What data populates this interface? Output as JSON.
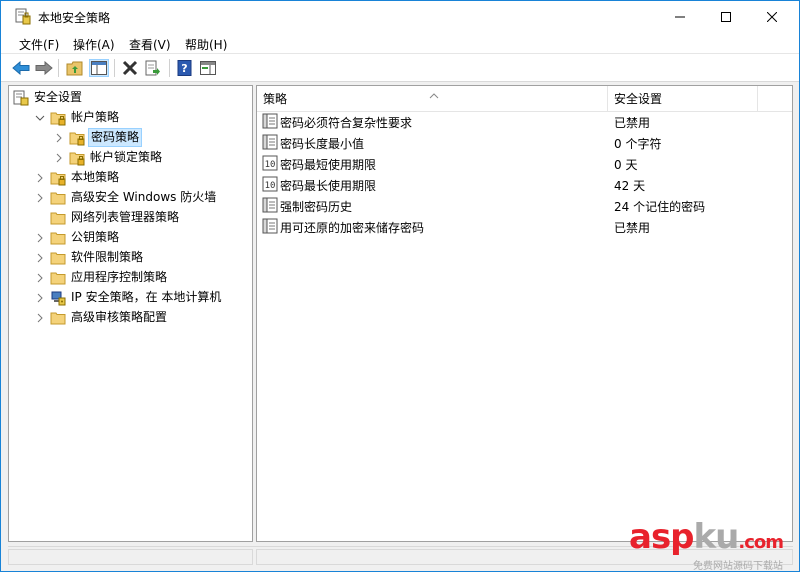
{
  "window": {
    "title": "本地安全策略",
    "app_icon": "security-policy-icon",
    "controls": [
      "minimize-icon",
      "maximize-icon",
      "close-icon"
    ]
  },
  "menu": {
    "file": "文件(F)",
    "action": "操作(A)",
    "view": "查看(V)",
    "help": "帮助(H)"
  },
  "toolbar": {
    "icons": [
      "back-arrow-icon",
      "forward-arrow-icon",
      "up-folder-icon",
      "show-hide-tree-icon",
      "delete-icon",
      "export-list-icon",
      "help-icon",
      "properties-pane-icon"
    ]
  },
  "tree": {
    "items": [
      {
        "label": "安全设置",
        "icon": "security-settings-icon",
        "level": 0,
        "expanded": true
      },
      {
        "label": "帐户策略",
        "icon": "folder-lock-icon",
        "level": 1,
        "expanded": true
      },
      {
        "label": "密码策略",
        "icon": "folder-lock-icon",
        "level": 2,
        "selected": true
      },
      {
        "label": "帐户锁定策略",
        "icon": "folder-lock-icon",
        "level": 2
      },
      {
        "label": "本地策略",
        "icon": "folder-lock-icon",
        "level": 1
      },
      {
        "label": "高级安全 Windows 防火墙",
        "icon": "folder-icon",
        "level": 1
      },
      {
        "label": "网络列表管理器策略",
        "icon": "folder-icon",
        "level": 1
      },
      {
        "label": "公钥策略",
        "icon": "folder-icon",
        "level": 1
      },
      {
        "label": "软件限制策略",
        "icon": "folder-icon",
        "level": 1
      },
      {
        "label": "应用程序控制策略",
        "icon": "folder-icon",
        "level": 1
      },
      {
        "label": "IP 安全策略，在 本地计算机",
        "icon": "ip-security-icon",
        "level": 1
      },
      {
        "label": "高级审核策略配置",
        "icon": "folder-icon",
        "level": 1
      }
    ]
  },
  "list": {
    "columns": [
      "策略",
      "安全设置"
    ],
    "rows": [
      {
        "policy": "密码必须符合复杂性要求",
        "setting": "已禁用",
        "icon": "policy-item-icon"
      },
      {
        "policy": "密码长度最小值",
        "setting": "0 个字符",
        "icon": "policy-item-icon"
      },
      {
        "policy": "密码最短使用期限",
        "setting": "0 天",
        "icon": "policy-number-icon"
      },
      {
        "policy": "密码最长使用期限",
        "setting": "42 天",
        "icon": "policy-number-icon"
      },
      {
        "policy": "强制密码历史",
        "setting": "24 个记住的密码",
        "icon": "policy-item-icon"
      },
      {
        "policy": "用可还原的加密来储存密码",
        "setting": "已禁用",
        "icon": "policy-item-icon"
      }
    ]
  },
  "watermark": {
    "main_asp": "asp",
    "main_ku": "ku",
    "main_com": ".com",
    "sub": "免费网站源码下载站"
  },
  "colors": {
    "accent": "#1883d7",
    "selection": "#cce8ff",
    "watermark_red": "#e8222c",
    "watermark_gray": "#aaaaaa"
  }
}
